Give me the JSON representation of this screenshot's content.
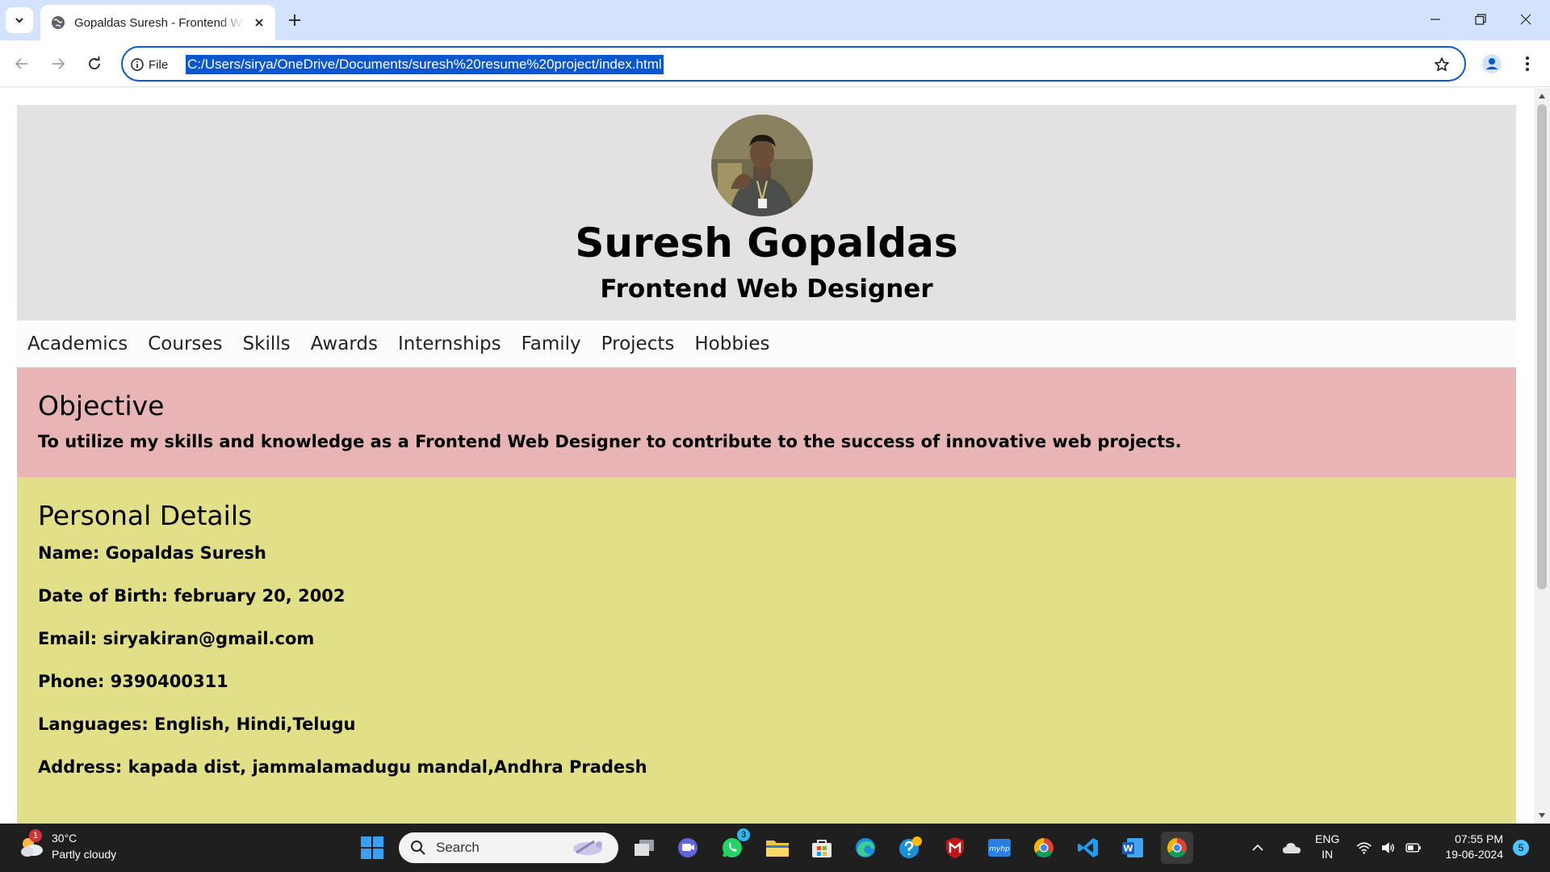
{
  "browser": {
    "tab_title": "Gopaldas Suresh - Frontend Web Designer",
    "new_tab_icon": "plus-icon",
    "site_info_label": "File",
    "url": "C:/Users/sirya/OneDrive/Documents/suresh%20resume%20project/index.html"
  },
  "resume": {
    "name": "Suresh Gopaldas",
    "role": "Frontend Web Designer",
    "nav": [
      "Academics",
      "Courses",
      "Skills",
      "Awards",
      "Internships",
      "Family",
      "Projects",
      "Hobbies"
    ],
    "objective": {
      "title": "Objective",
      "text": "To utilize my skills and knowledge as a Frontend Web Designer to contribute to the success of innovative web projects."
    },
    "personal": {
      "title": "Personal Details",
      "name": "Name: Gopaldas Suresh",
      "dob": "Date of Birth: february 20, 2002",
      "email": "Email: siryakiran@gmail.com",
      "phone": "Phone: 9390400311",
      "languages": "Languages: English, Hindi,Telugu",
      "address": "Address: kapada dist, jammalamadugu mandal,Andhra Pradesh"
    },
    "colors": {
      "header_bg": "#e3e1e2",
      "objective_bg": "#e8b4b5",
      "personal_bg": "#e1e088"
    }
  },
  "taskbar": {
    "weather_temp": "30°C",
    "weather_desc": "Partly cloudy",
    "weather_badge": "1",
    "search_label": "Search",
    "whatsapp_badge": "3",
    "lang_line1": "ENG",
    "lang_line2": "IN",
    "time": "07:55 PM",
    "date": "19-06-2024",
    "notification_count": "5"
  }
}
